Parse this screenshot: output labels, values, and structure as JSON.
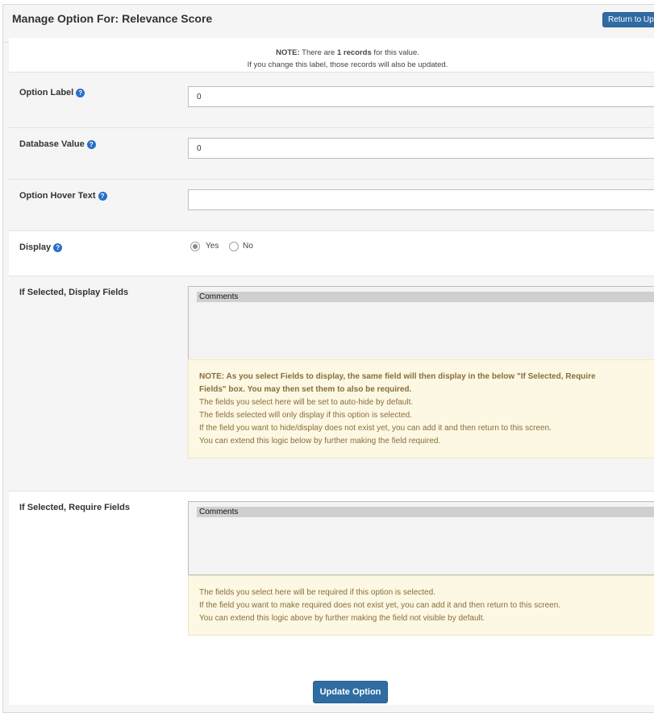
{
  "header": {
    "title": "Manage Option For: Relevance Score",
    "return_button": "Return to Upd"
  },
  "note": {
    "prefix": "NOTE:",
    "text_before": " There are ",
    "count": "1 records",
    "text_after": " for this value.",
    "line2": "If you change this label, those records will also be updated."
  },
  "fields": {
    "option_label": {
      "label": "Option Label",
      "value": "0"
    },
    "database_value": {
      "label": "Database Value",
      "value": "0"
    },
    "hover_text": {
      "label": "Option Hover Text",
      "value": ""
    },
    "display": {
      "label": "Display",
      "options": [
        "Yes",
        "No"
      ],
      "selected": "Yes"
    },
    "display_fields": {
      "label": "If Selected, Display Fields",
      "list_items": [
        "Comments"
      ],
      "note_bold_1": "NOTE: As you select Fields to display, the same field will then display in the below \"If Selected, Require",
      "note_bold_2": "Fields\" box. You may then set them to also be required.",
      "note_lines": [
        "The fields you select here will be set to auto-hide by default.",
        "The fields selected will only display if this option is selected.",
        "If the field you want to hide/display does not exist yet, you can add it and then return to this screen.",
        "You can extend this logic below by further making the field required."
      ]
    },
    "require_fields": {
      "label": "If Selected, Require Fields",
      "list_items": [
        "Comments"
      ],
      "note_lines": [
        "The fields you select here will be required if this option is selected.",
        "If the field you want to make required does not exist yet, you can add it and then return to this screen.",
        "You can extend this logic above by further making the field not visible by default."
      ]
    }
  },
  "footer": {
    "update_button": "Update Option"
  },
  "colors": {
    "primary": "#2f6ca3",
    "help_icon": "#2a6fc9",
    "warning_bg": "#fcf8e3",
    "warning_text": "#8a6d3b"
  },
  "icons": {
    "help": "question-circle-icon"
  }
}
